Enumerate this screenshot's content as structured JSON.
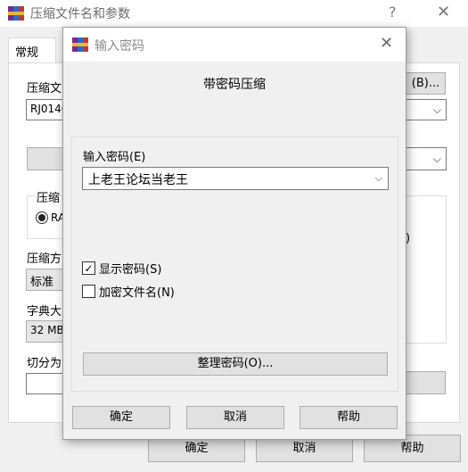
{
  "background_window": {
    "title": "压缩文件名和参数",
    "help_icon": "?",
    "close_icon": "✕",
    "tab_general": "常规",
    "archive_name_label": "压缩文",
    "archive_name_value": "RJ0140",
    "browse_button": "(B)...",
    "format_group_label": "压缩",
    "format_radio": "RA",
    "method_label": "压缩方",
    "method_value": "标准",
    "dict_label": "字典大",
    "dict_value": "32 MB",
    "split_label": "切分为",
    "partial_right_text": ")",
    "ok_button": "确定",
    "cancel_button": "取消",
    "help_button": "帮助"
  },
  "dialog": {
    "title": "输入密码",
    "close_icon": "✕",
    "heading": "带密码压缩",
    "password_label": "输入密码(E)",
    "password_value": "上老王论坛当老王",
    "show_password": {
      "label": "显示密码(S)",
      "checked": true
    },
    "encrypt_filenames": {
      "label": "加密文件名(N)",
      "checked": false
    },
    "manage_button": "整理密码(O)...",
    "ok_button": "确定",
    "cancel_button": "取消",
    "help_button": "帮助"
  },
  "colors": {
    "window_bg": "#f0f0f0",
    "button_bg": "#e1e1e1",
    "button_border": "#adadad"
  }
}
